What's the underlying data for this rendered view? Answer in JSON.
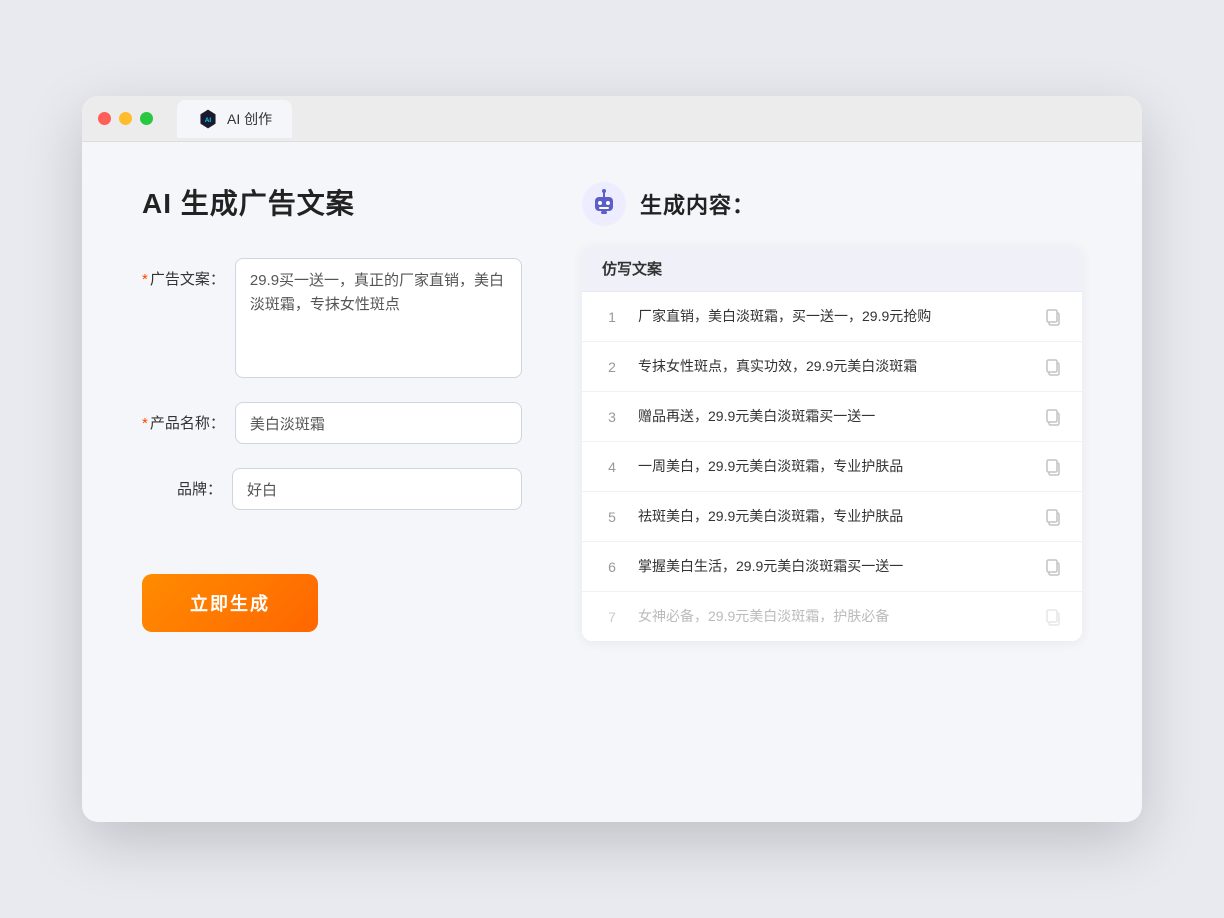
{
  "tab": {
    "label": "AI 创作"
  },
  "page": {
    "title": "AI 生成广告文案"
  },
  "form": {
    "ad_copy_label": "广告文案：",
    "ad_copy_required": "*",
    "ad_copy_value": "29.9买一送一，真正的厂家直销，美白淡斑霜，专抹女性斑点",
    "product_name_label": "产品名称：",
    "product_name_required": "*",
    "product_name_value": "美白淡斑霜",
    "brand_label": "品牌：",
    "brand_value": "好白",
    "generate_btn_label": "立即生成"
  },
  "result": {
    "header_title": "生成内容：",
    "column_label": "仿写文案",
    "items": [
      {
        "num": "1",
        "text": "厂家直销，美白淡斑霜，买一送一，29.9元抢购",
        "dimmed": false
      },
      {
        "num": "2",
        "text": "专抹女性斑点，真实功效，29.9元美白淡斑霜",
        "dimmed": false
      },
      {
        "num": "3",
        "text": "赠品再送，29.9元美白淡斑霜买一送一",
        "dimmed": false
      },
      {
        "num": "4",
        "text": "一周美白，29.9元美白淡斑霜，专业护肤品",
        "dimmed": false
      },
      {
        "num": "5",
        "text": "祛斑美白，29.9元美白淡斑霜，专业护肤品",
        "dimmed": false
      },
      {
        "num": "6",
        "text": "掌握美白生活，29.9元美白淡斑霜买一送一",
        "dimmed": false
      },
      {
        "num": "7",
        "text": "女神必备，29.9元美白淡斑霜，护肤必备",
        "dimmed": true
      }
    ]
  }
}
